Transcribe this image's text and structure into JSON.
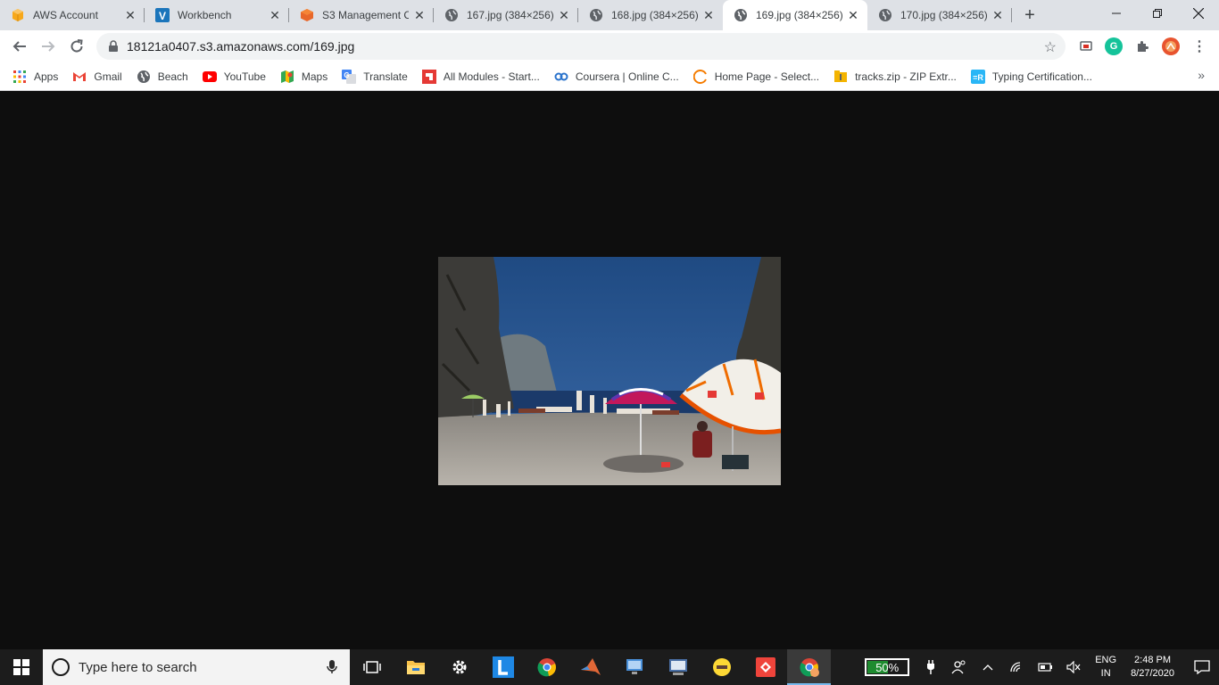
{
  "browser": {
    "tabs": [
      {
        "title": "AWS Account",
        "icon": "aws-box-icon",
        "active": false
      },
      {
        "title": "Workbench",
        "icon": "vocareum-icon",
        "active": false
      },
      {
        "title": "S3 Management C",
        "icon": "s3-bucket-icon",
        "active": false
      },
      {
        "title": "167.jpg (384×256)",
        "icon": "globe-icon",
        "active": false
      },
      {
        "title": "168.jpg (384×256)",
        "icon": "globe-icon",
        "active": false
      },
      {
        "title": "169.jpg (384×256)",
        "icon": "globe-icon",
        "active": true
      },
      {
        "title": "170.jpg (384×256)",
        "icon": "globe-icon",
        "active": false
      }
    ],
    "url": "18121a0407.s3.amazonaws.com/169.jpg",
    "bookmarks": [
      {
        "label": "Apps",
        "icon": "apps-grid-icon"
      },
      {
        "label": "Gmail",
        "icon": "gmail-icon"
      },
      {
        "label": "Beach",
        "icon": "globe-icon"
      },
      {
        "label": "YouTube",
        "icon": "youtube-icon"
      },
      {
        "label": "Maps",
        "icon": "maps-icon"
      },
      {
        "label": "Translate",
        "icon": "translate-icon"
      },
      {
        "label": "All Modules - Start...",
        "icon": "modules-icon"
      },
      {
        "label": "Coursera | Online C...",
        "icon": "coursera-icon"
      },
      {
        "label": "Home Page - Select...",
        "icon": "home-page-icon"
      },
      {
        "label": "tracks.zip - ZIP Extr...",
        "icon": "zip-icon"
      },
      {
        "label": "Typing Certification...",
        "icon": "typing-icon"
      }
    ]
  },
  "taskbar": {
    "search_placeholder": "Type here to search",
    "battery_percent": "50%",
    "battery_level": 0.5,
    "language_line1": "ENG",
    "language_line2": "IN",
    "time": "2:48 PM",
    "date": "8/27/2020"
  },
  "colors": {
    "tabstrip": "#dee1e6",
    "content_bg": "#0e0e0e",
    "taskbar": "#1c1c1c",
    "accent_blue": "#1a73e8"
  }
}
